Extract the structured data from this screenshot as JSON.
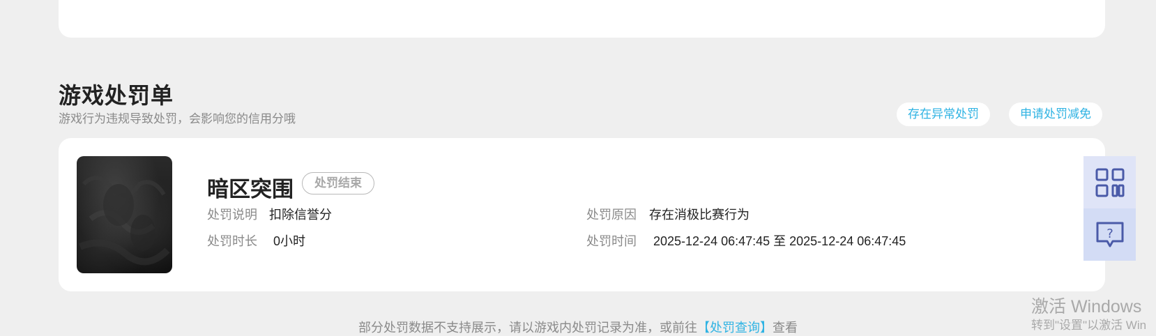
{
  "section": {
    "title": "游戏处罚单",
    "subtitle": "游戏行为违规导致处罚，会影响您的信用分哦"
  },
  "actions": {
    "abnormal_label": "存在异常处罚",
    "reduce_label": "申请处罚减免"
  },
  "record": {
    "game_name": "暗区突围",
    "status": "处罚结束",
    "fields": {
      "desc_label": "处罚说明",
      "desc_value": "扣除信誉分",
      "reason_label": "处罚原因",
      "reason_value": "存在消极比赛行为",
      "duration_label": "处罚时长",
      "duration_value": "0小时",
      "time_label": "处罚时间",
      "time_value": "2025-12-24 06:47:45 至 2025-12-24 06:47:45"
    }
  },
  "side": {
    "qr_icon": "qr-code-icon",
    "help_icon": "help-chat-icon"
  },
  "footer": {
    "prefix": "部分处罚数据不支持展示，请以游戏内处罚记录为准，或前往",
    "link": "【处罚查询】",
    "suffix": "查看"
  },
  "watermark": {
    "line1": "激活 Windows",
    "line2": "转到\"设置\"以激活 Win"
  },
  "colors": {
    "background": "#efefef",
    "card": "#ffffff",
    "accent": "#2fb3e3",
    "side_qr": "#dfe4f7",
    "side_help": "#d3dcf5",
    "icon": "#4a5aa8"
  }
}
